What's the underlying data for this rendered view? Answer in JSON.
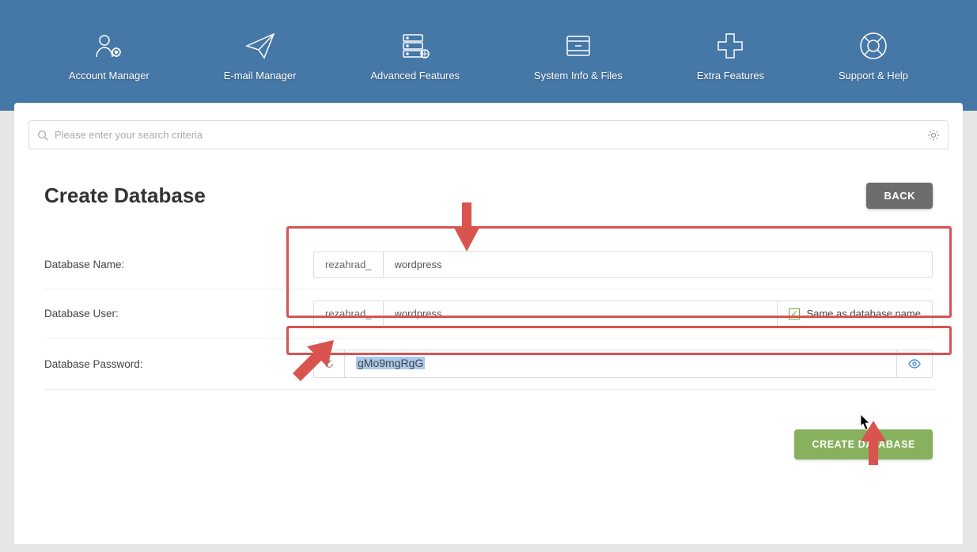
{
  "nav": {
    "items": [
      {
        "label": "Account Manager"
      },
      {
        "label": "E-mail Manager"
      },
      {
        "label": "Advanced Features"
      },
      {
        "label": "System Info & Files"
      },
      {
        "label": "Extra Features"
      },
      {
        "label": "Support & Help"
      }
    ]
  },
  "search": {
    "placeholder": "Please enter your search criteria"
  },
  "page": {
    "title": "Create Database",
    "back_label": "BACK"
  },
  "form": {
    "db_name_label": "Database Name:",
    "db_name_prefix": "rezahrad_",
    "db_name_value": "wordpress",
    "db_user_label": "Database User:",
    "db_user_prefix": "rezahrad_",
    "db_user_value": "wordpress",
    "same_as_label": "Same as database name",
    "db_pwd_label": "Database Password:",
    "db_pwd_value": "gMo9mgRgG",
    "submit_label": "CREATE DATABASE"
  },
  "colors": {
    "header": "#4577a7",
    "accent_green": "#87b15f",
    "annot_red": "#d9534f"
  }
}
